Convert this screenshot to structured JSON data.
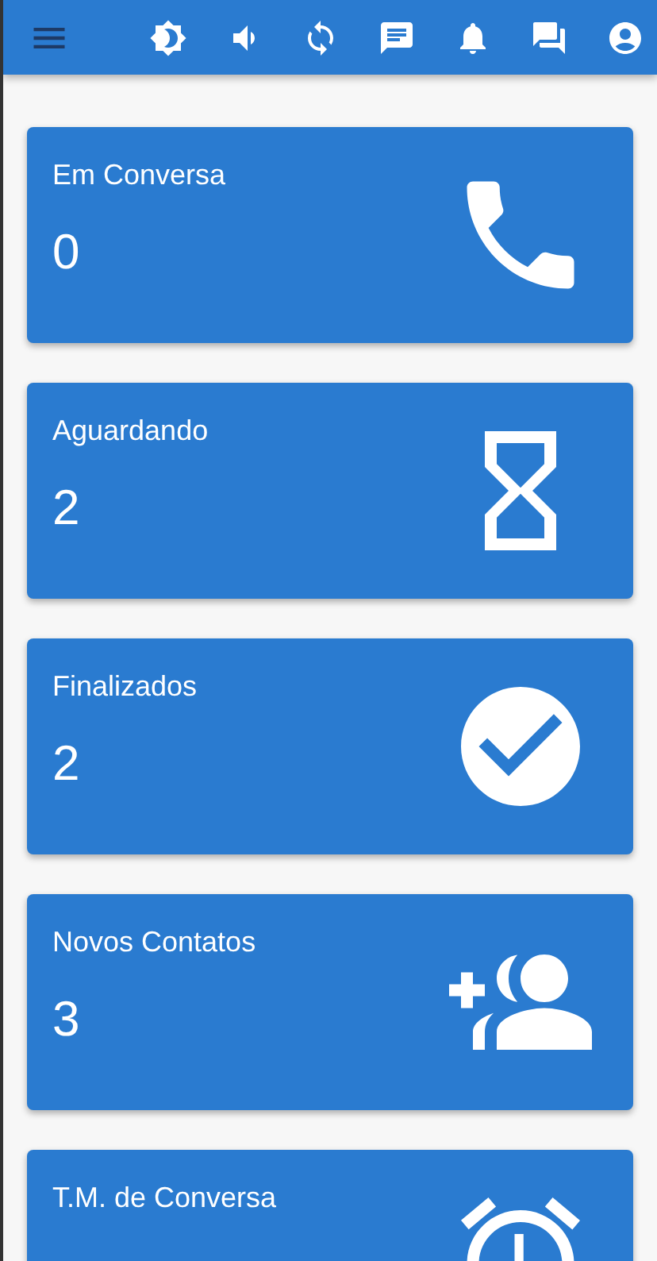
{
  "toolbar": {
    "actions": [
      {
        "kind": "brightness"
      },
      {
        "kind": "volume"
      },
      {
        "kind": "sync"
      },
      {
        "kind": "chat"
      },
      {
        "kind": "bell"
      },
      {
        "kind": "forum"
      },
      {
        "kind": "account"
      }
    ]
  },
  "cards": [
    {
      "title": "Em Conversa",
      "value": "0",
      "kind": "phone"
    },
    {
      "title": "Aguardando",
      "value": "2",
      "kind": "hourglass"
    },
    {
      "title": "Finalizados",
      "value": "2",
      "kind": "check"
    },
    {
      "title": "Novos Contatos",
      "value": "3",
      "kind": "group-add"
    },
    {
      "title": "T.M. de Conversa",
      "kind": "alarm"
    }
  ]
}
